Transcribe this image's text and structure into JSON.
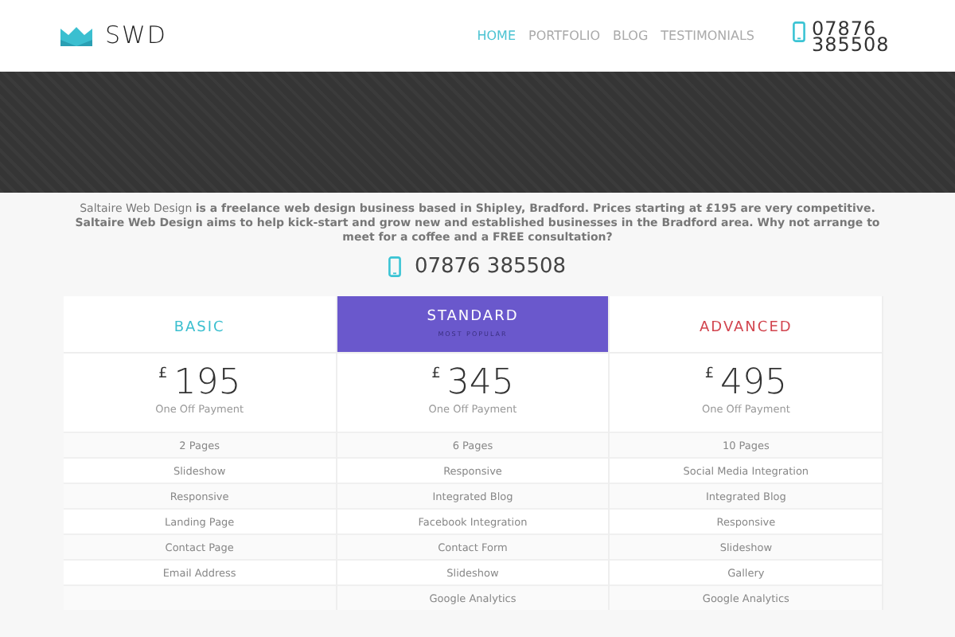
{
  "logo": {
    "text": "SWD"
  },
  "nav": [
    {
      "label": "HOME",
      "selected": true
    },
    {
      "label": "PORTFOLIO",
      "selected": false
    },
    {
      "label": "BLOG",
      "selected": false
    },
    {
      "label": "TESTIMONIALS",
      "selected": false
    }
  ],
  "header_phone": "07876 385508",
  "intro": {
    "text": "Saltaire Web Design **is a freelance web design business based in Shipley, Bradford. Prices starting at £195 are very competitive. Saltaire Web Design aims to help kick-start and grow new and established businesses in the Bradford area. Why not arrange to meet for a coffee and a FREE consultation?**",
    "phone": "07876 385508"
  },
  "plans": [
    {
      "name": "BASIC",
      "color": "#3bbfcf",
      "featured": false,
      "currency": "£",
      "price": "195",
      "period": "One Off Payment",
      "features": [
        "2 Pages",
        "Slideshow",
        "Responsive",
        "Landing Page",
        "Contact Page",
        "Email Address"
      ]
    },
    {
      "name": "STANDARD",
      "color": "#6a58cc",
      "featured": true,
      "subtitle": "MOST POPULAR",
      "currency": "£",
      "price": "345",
      "period": "One Off Payment",
      "features": [
        "6 Pages",
        "Responsive",
        "Integrated Blog",
        "Facebook Integration",
        "Contact Form",
        "Slideshow",
        "Google Analytics"
      ]
    },
    {
      "name": "ADVANCED",
      "color": "#d2454f",
      "featured": false,
      "currency": "£",
      "price": "495",
      "period": "One Off Payment",
      "features": [
        "10 Pages",
        "Social Media Integration",
        "Integrated Blog",
        "Responsive",
        "Slideshow",
        "Gallery",
        "Google Analytics"
      ]
    }
  ]
}
